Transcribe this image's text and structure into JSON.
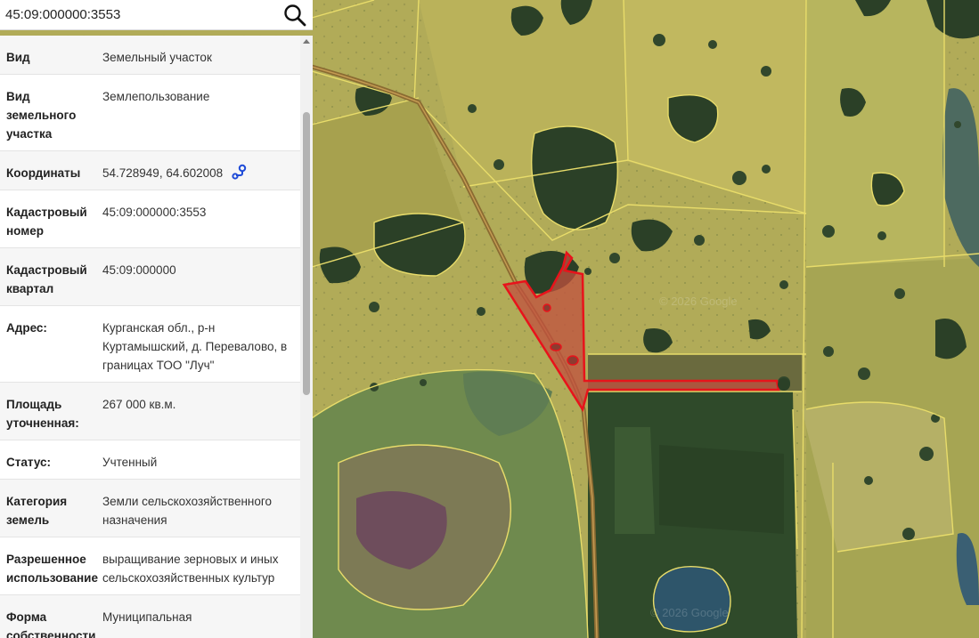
{
  "search": {
    "value": "45:09:000000:3553",
    "placeholder": ""
  },
  "icons": {
    "search": "search-icon",
    "coordinates": "location-pin-icon"
  },
  "colors": {
    "parcel_outline": "#e8131b",
    "parcel_fill": "#c2503f",
    "boundary": "#e8dc6a",
    "farmland": "#b4ad52",
    "forest": "#2b4027",
    "water": "#2a4e63",
    "road": "#8a6b32"
  },
  "map": {
    "watermark": "© 2026 Google"
  },
  "rows": [
    {
      "key": "Вид",
      "value": "Земельный участок"
    },
    {
      "key": "Вид земельного участка",
      "value": "Землепользование"
    },
    {
      "key": "Координаты",
      "value": "54.728949, 64.602008"
    },
    {
      "key": "Кадастровый номер",
      "value": "45:09:000000:3553"
    },
    {
      "key": "Кадастровый квартал",
      "value": "45:09:000000"
    },
    {
      "key": "Адрес:",
      "value": "Курганская обл., р-н Куртамышский, д. Перевалово, в границах ТОО \"Луч\""
    },
    {
      "key": "Площадь уточненная:",
      "value": "267 000 кв.м."
    },
    {
      "key": "Статус:",
      "value": "Учтенный"
    },
    {
      "key": "Категория земель",
      "value": "Земли сельскохозяйственного назначения"
    },
    {
      "key": "Разрешенное использование",
      "value": "выращивание зерновых и иных сельскохозяйственных культур"
    },
    {
      "key": "Форма собственности",
      "value": "Муниципальная"
    }
  ]
}
